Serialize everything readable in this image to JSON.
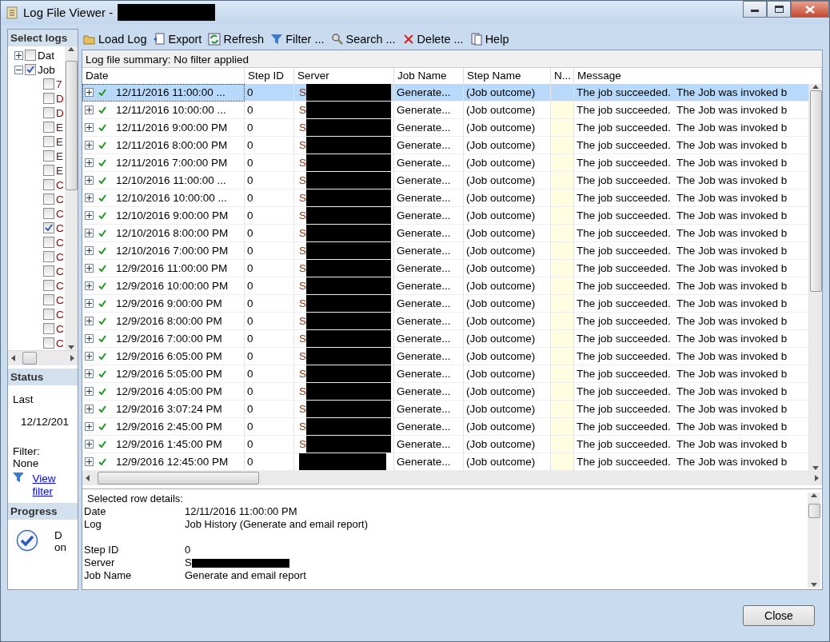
{
  "window": {
    "title": "Log File Viewer -"
  },
  "sidebar": {
    "select_logs": {
      "title": "Select logs",
      "tree": [
        {
          "label": "Dat",
          "checked": false,
          "expanded": false
        },
        {
          "label": "Job",
          "checked": true,
          "expanded": true,
          "children": [
            {
              "label": "7",
              "checked": false
            },
            {
              "label": "D",
              "checked": false
            },
            {
              "label": "D",
              "checked": false
            },
            {
              "label": "E",
              "checked": false
            },
            {
              "label": "E",
              "checked": false
            },
            {
              "label": "E",
              "checked": false
            },
            {
              "label": "E",
              "checked": false
            },
            {
              "label": "C",
              "checked": false
            },
            {
              "label": "C",
              "checked": false
            },
            {
              "label": "C",
              "checked": false
            },
            {
              "label": "C",
              "checked": true
            },
            {
              "label": "C",
              "checked": false
            },
            {
              "label": "C",
              "checked": false
            },
            {
              "label": "C",
              "checked": false
            },
            {
              "label": "C",
              "checked": false
            },
            {
              "label": "C",
              "checked": false
            },
            {
              "label": "C",
              "checked": false
            },
            {
              "label": "C",
              "checked": false
            },
            {
              "label": "C",
              "checked": false
            }
          ]
        }
      ]
    },
    "status": {
      "title": "Status",
      "last_label": "Last",
      "last_value": "12/12/201",
      "filter_label": "Filter:",
      "filter_value": "None",
      "view_filter_link": "View filter"
    },
    "progress": {
      "title": "Progress",
      "text_1": "D",
      "text_2": "on"
    }
  },
  "toolbar": [
    "Load Log",
    "Export",
    "Refresh",
    "Filter ...",
    "Search ...",
    "Delete ...",
    "Help"
  ],
  "summary": "Log file summary: No filter applied",
  "table": {
    "columns": [
      "Date",
      "Step ID",
      "Server",
      "Job Name",
      "Step Name",
      "N...",
      "Message"
    ],
    "rows": [
      {
        "date": "12/11/2016 11:00:00 ...",
        "step_id": "0",
        "server": "S",
        "job_name": "Generate...",
        "step_name": "(Job outcome)",
        "message": "The job succeeded.  The Job was invoked b",
        "selected": true
      },
      {
        "date": "12/11/2016 10:00:00 ...",
        "step_id": "0",
        "server": "S",
        "job_name": "Generate...",
        "step_name": "(Job outcome)",
        "message": "The job succeeded.  The Job was invoked b",
        "selected": false
      },
      {
        "date": "12/11/2016 9:00:00 PM",
        "step_id": "0",
        "server": "S",
        "job_name": "Generate...",
        "step_name": "(Job outcome)",
        "message": "The job succeeded.  The Job was invoked b",
        "selected": false
      },
      {
        "date": "12/11/2016 8:00:00 PM",
        "step_id": "0",
        "server": "S",
        "job_name": "Generate...",
        "step_name": "(Job outcome)",
        "message": "The job succeeded.  The Job was invoked b",
        "selected": false
      },
      {
        "date": "12/11/2016 7:00:00 PM",
        "step_id": "0",
        "server": "S",
        "job_name": "Generate...",
        "step_name": "(Job outcome)",
        "message": "The job succeeded.  The Job was invoked b",
        "selected": false
      },
      {
        "date": "12/10/2016 11:00:00 ...",
        "step_id": "0",
        "server": "S",
        "job_name": "Generate...",
        "step_name": "(Job outcome)",
        "message": "The job succeeded.  The Job was invoked b",
        "selected": false
      },
      {
        "date": "12/10/2016 10:00:00 ...",
        "step_id": "0",
        "server": "S",
        "job_name": "Generate...",
        "step_name": "(Job outcome)",
        "message": "The job succeeded.  The Job was invoked b",
        "selected": false
      },
      {
        "date": "12/10/2016 9:00:00 PM",
        "step_id": "0",
        "server": "S",
        "job_name": "Generate...",
        "step_name": "(Job outcome)",
        "message": "The job succeeded.  The Job was invoked b",
        "selected": false
      },
      {
        "date": "12/10/2016 8:00:00 PM",
        "step_id": "0",
        "server": "S",
        "job_name": "Generate...",
        "step_name": "(Job outcome)",
        "message": "The job succeeded.  The Job was invoked b",
        "selected": false
      },
      {
        "date": "12/10/2016 7:00:00 PM",
        "step_id": "0",
        "server": "S",
        "job_name": "Generate...",
        "step_name": "(Job outcome)",
        "message": "The job succeeded.  The Job was invoked b",
        "selected": false
      },
      {
        "date": "12/9/2016 11:00:00 PM",
        "step_id": "0",
        "server": "S",
        "job_name": "Generate...",
        "step_name": "(Job outcome)",
        "message": "The job succeeded.  The Job was invoked b",
        "selected": false
      },
      {
        "date": "12/9/2016 10:00:00 PM",
        "step_id": "0",
        "server": "S",
        "job_name": "Generate...",
        "step_name": "(Job outcome)",
        "message": "The job succeeded.  The Job was invoked b",
        "selected": false
      },
      {
        "date": "12/9/2016 9:00:00 PM",
        "step_id": "0",
        "server": "S",
        "job_name": "Generate...",
        "step_name": "(Job outcome)",
        "message": "The job succeeded.  The Job was invoked b",
        "selected": false
      },
      {
        "date": "12/9/2016 8:00:00 PM",
        "step_id": "0",
        "server": "S",
        "job_name": "Generate...",
        "step_name": "(Job outcome)",
        "message": "The job succeeded.  The Job was invoked b",
        "selected": false
      },
      {
        "date": "12/9/2016 7:00:00 PM",
        "step_id": "0",
        "server": "S",
        "job_name": "Generate...",
        "step_name": "(Job outcome)",
        "message": "The job succeeded.  The Job was invoked b",
        "selected": false
      },
      {
        "date": "12/9/2016 6:05:00 PM",
        "step_id": "0",
        "server": "S",
        "job_name": "Generate...",
        "step_name": "(Job outcome)",
        "message": "The job succeeded.  The Job was invoked b",
        "selected": false
      },
      {
        "date": "12/9/2016 5:05:00 PM",
        "step_id": "0",
        "server": "S",
        "job_name": "Generate...",
        "step_name": "(Job outcome)",
        "message": "The job succeeded.  The Job was invoked b",
        "selected": false
      },
      {
        "date": "12/9/2016 4:05:00 PM",
        "step_id": "0",
        "server": "S",
        "job_name": "Generate...",
        "step_name": "(Job outcome)",
        "message": "The job succeeded.  The Job was invoked b",
        "selected": false
      },
      {
        "date": "12/9/2016 3:07:24 PM",
        "step_id": "0",
        "server": "S",
        "job_name": "Generate...",
        "step_name": "(Job outcome)",
        "message": "The job succeeded.  The Job was invoked b",
        "selected": false
      },
      {
        "date": "12/9/2016 2:45:00 PM",
        "step_id": "0",
        "server": "S",
        "job_name": "Generate...",
        "step_name": "(Job outcome)",
        "message": "The job succeeded.  The Job was invoked b",
        "selected": false
      },
      {
        "date": "12/9/2016 1:45:00 PM",
        "step_id": "0",
        "server": "S",
        "job_name": "Generate...",
        "step_name": "(Job outcome)",
        "message": "The job succeeded.  The Job was invoked b",
        "selected": false
      },
      {
        "date": "12/9/2016 12:45:00 PM",
        "step_id": "0",
        "server": "",
        "job_name": "Generate...",
        "step_name": "(Job outcome)",
        "message": "The job succeeded.  The Job was invoked b",
        "selected": false
      }
    ]
  },
  "details": {
    "title": "Selected row details:",
    "fields": [
      {
        "label": "Date",
        "value": "12/11/2016 11:00:00 PM"
      },
      {
        "label": "Log",
        "value": "Job History (Generate and email report)"
      },
      {
        "kind": "spacer"
      },
      {
        "label": "Step ID",
        "value": "0"
      },
      {
        "label": "Server",
        "value": "S",
        "kind": "redacted"
      },
      {
        "label": "Job Name",
        "value": "Generate and email report"
      }
    ]
  },
  "buttons": [
    "Close"
  ]
}
